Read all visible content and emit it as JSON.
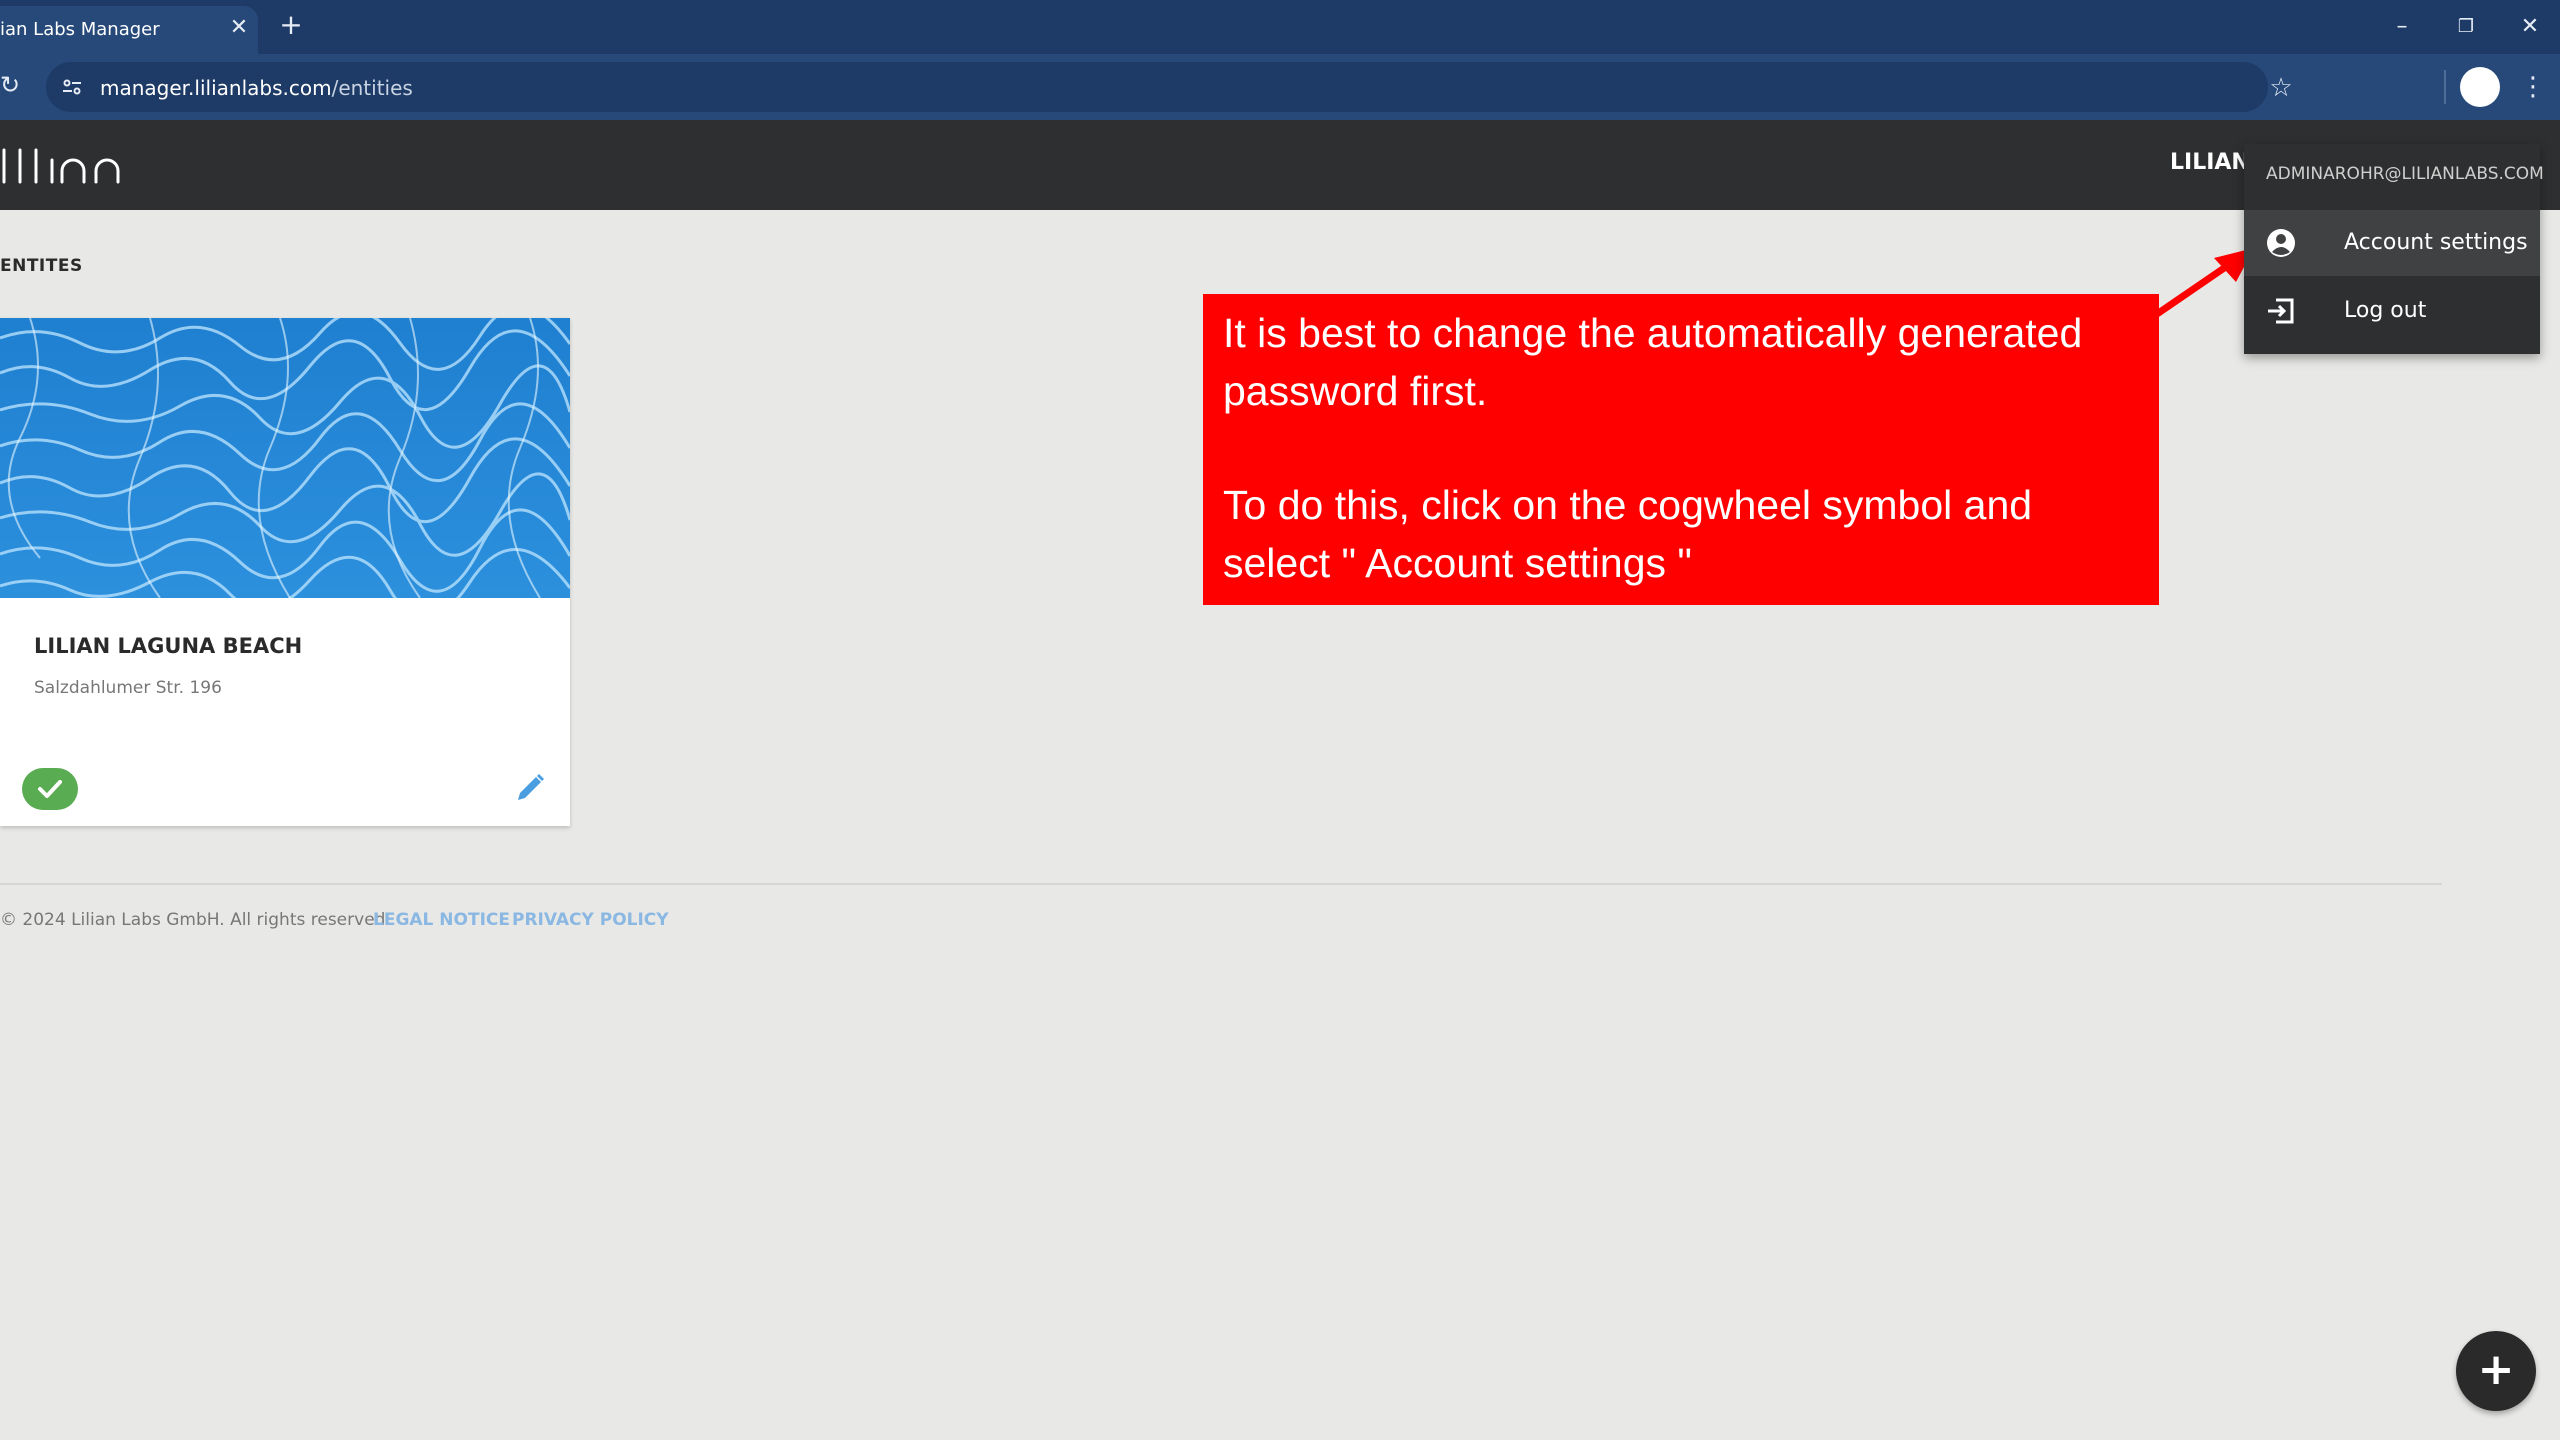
{
  "browser": {
    "tab_title": "ian Labs Manager",
    "tab_close": "✕",
    "new_tab": "+",
    "url_host": "manager.lilianlabs.com",
    "url_path": "/entities",
    "window_min": "–",
    "window_max": "❐",
    "window_close": "✕",
    "reload": "↻",
    "star": "☆",
    "menu": "⋮"
  },
  "app": {
    "logo_text": "lilian",
    "entity_name": "LILIAN L",
    "section_title": "ENTITES"
  },
  "card": {
    "name": "LILIAN LAGUNA BEACH",
    "address": "Salzdahlumer Str. 196",
    "status": "active",
    "status_color": "#5aac52",
    "edit_icon": "pencil-icon"
  },
  "footer": {
    "copyright": "© 2024 Lilian Labs GmbH. All rights reserved.",
    "legal_notice": "LEGAL NOTICE",
    "privacy_policy": "PRIVACY POLICY"
  },
  "dropdown": {
    "email": "ADMINAROHR@LILIANLABS.COM",
    "items": [
      {
        "label": "Account settings",
        "icon": "account-circle-icon"
      },
      {
        "label": "Log out",
        "icon": "logout-icon"
      }
    ]
  },
  "annotation": {
    "paragraph1": "It is best to change the automatically generated password first.",
    "paragraph2": "To do this, click on the cogwheel symbol and select \" Account settings \"",
    "color": "#ff0000"
  },
  "fab": {
    "label": "+"
  },
  "colors": {
    "browser_frame": "#1d3b66",
    "toolbar": "#26497a",
    "app_header": "#2e2f30",
    "page_background": "#e8e8e6",
    "link": "#8ab8e3"
  }
}
